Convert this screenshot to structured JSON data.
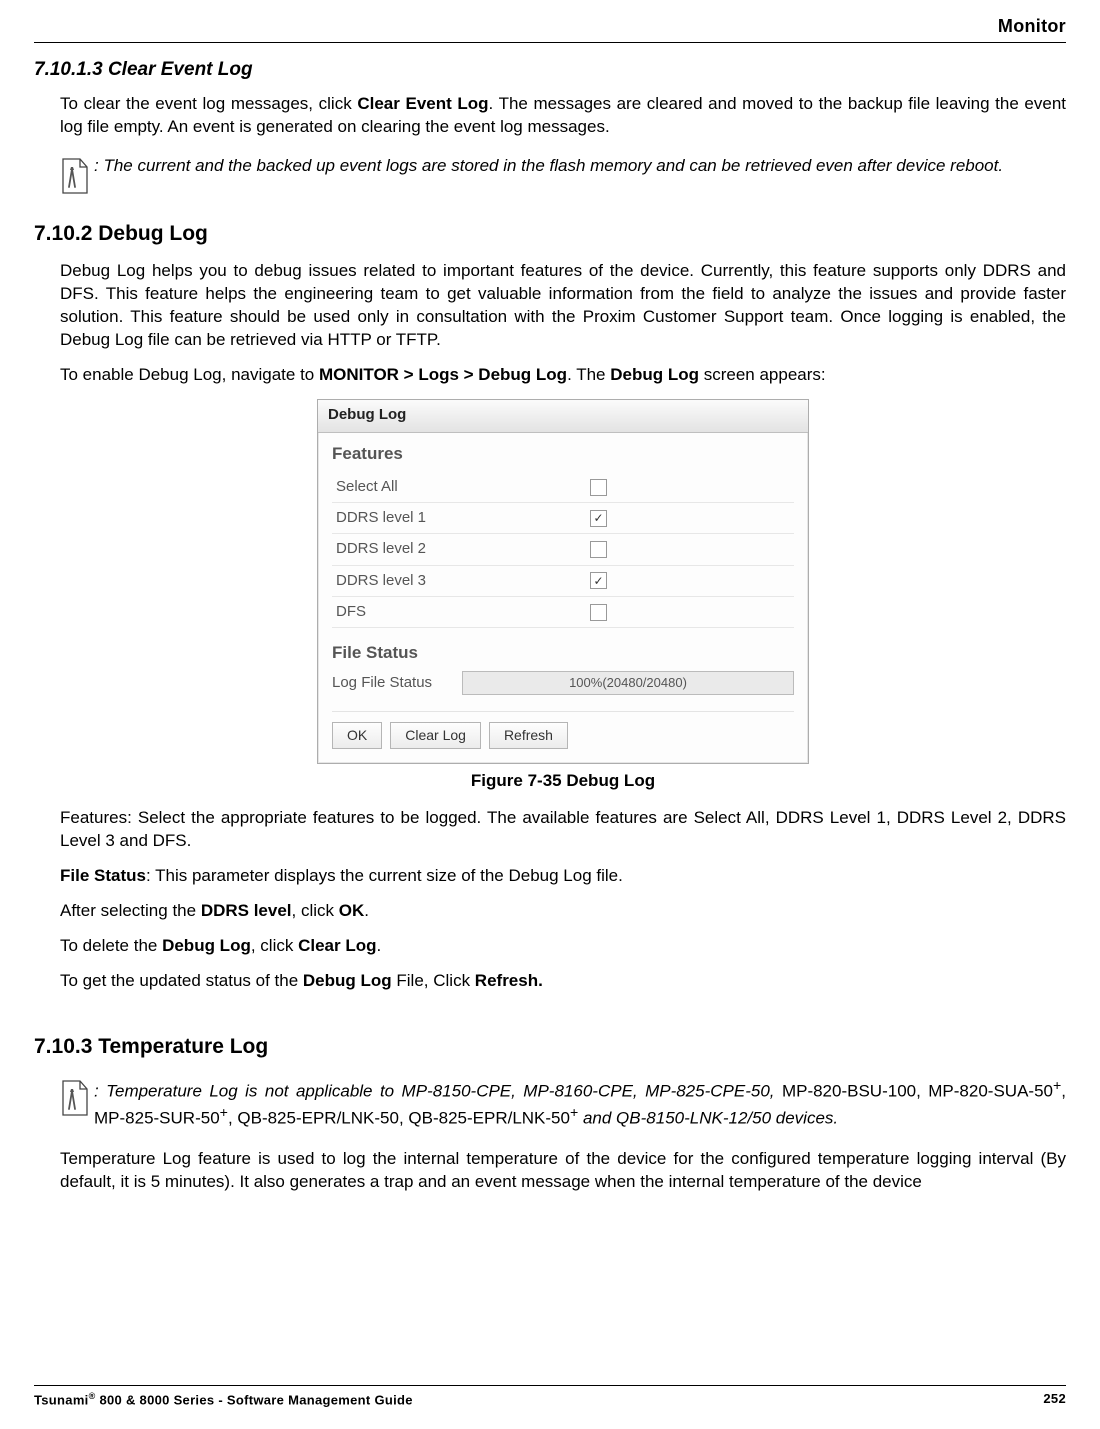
{
  "header": {
    "chapter": "Monitor"
  },
  "s1": {
    "heading": "7.10.1.3 Clear Event Log",
    "p1a": "To clear the event log messages, click ",
    "p1b": "Clear Event Log",
    "p1c": ". The messages are cleared and moved to the backup file leaving the event log file empty. An event is generated on clearing the event log messages.",
    "note": ": The current and the backed up event logs are stored in the flash memory and can be retrieved even after device reboot."
  },
  "s2": {
    "heading": "7.10.2 Debug Log",
    "p1": "Debug Log helps you to debug issues related to important features of the device. Currently, this feature supports only DDRS and DFS. This feature helps the engineering team to get valuable information from the field to analyze the issues and provide faster solution. This feature should be used only in consultation with the Proxim Customer Support team. Once logging is enabled, the Debug Log file can be retrieved via HTTP or TFTP.",
    "p2a": "To enable Debug Log, navigate to ",
    "p2b": "MONITOR > Logs > Debug Log",
    "p2c": ". The ",
    "p2d": "Debug Log",
    "p2e": " screen appears:",
    "fig_caption": "Figure 7-35 Debug Log",
    "p3": "Features: Select the appropriate features to be logged. The available features are Select All, DDRS Level 1, DDRS Level 2, DDRS Level 3 and DFS.",
    "p4a": "File Status",
    "p4b": ": This parameter displays the current size of the Debug Log file.",
    "p5a": "After selecting the ",
    "p5b": "DDRS level",
    "p5c": ", click ",
    "p5d": "OK",
    "p5e": ".",
    "p6a": "To delete the ",
    "p6b": "Debug Log",
    "p6c": ", click ",
    "p6d": "Clear Log",
    "p6e": ".",
    "p7a": "To get the updated status of the ",
    "p7b": "Debug Log",
    "p7c": " File, Click ",
    "p7d": "Refresh.",
    "ui": {
      "tab": "Debug Log",
      "features_title": "Features",
      "rows": {
        "r0": "Select All",
        "r1": "DDRS level 1",
        "r2": "DDRS level 2",
        "r3": "DDRS level 3",
        "r4": "DFS"
      },
      "checks": {
        "r0": "",
        "r1": "✓",
        "r2": "",
        "r3": "✓",
        "r4": ""
      },
      "file_status_title": "File Status",
      "file_status_label": "Log File Status",
      "file_status_value": "100%(20480/20480)",
      "btn_ok": "OK",
      "btn_clear": "Clear Log",
      "btn_refresh": "Refresh"
    }
  },
  "s3": {
    "heading": "7.10.3 Temperature Log",
    "note_a": ": Temperature Log is not applicable to  MP-8150-CPE, MP-8160-CPE, MP-825-CPE-50, ",
    "note_b": "MP-820-BSU-100, MP-820-SUA-50",
    "note_c": ", MP-825-SUR-50",
    "note_d": ", QB-825-EPR/LNK-50, QB-825-EPR/LNK-50",
    "note_e": " and QB-8150-LNK-12/50 devices.",
    "p1": "Temperature Log feature is used to log the internal temperature of the device for the configured temperature logging interval (By default, it is 5 minutes). It also generates a trap and an event message when the internal temperature of the device"
  },
  "footer": {
    "left_a": "Tsunami",
    "left_b": " 800 & 8000 Series - Software Management Guide",
    "page": "252"
  }
}
